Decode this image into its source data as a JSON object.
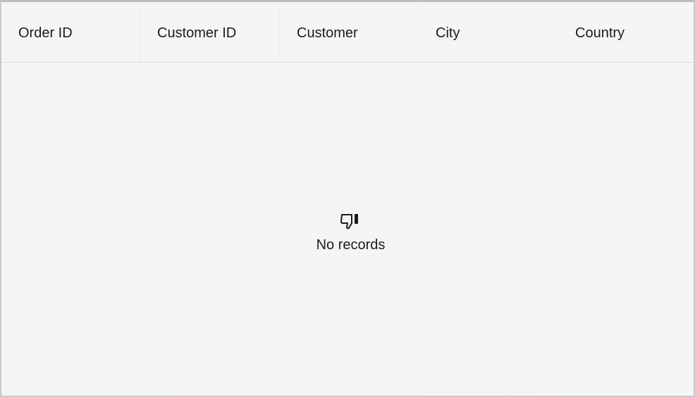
{
  "grid": {
    "columns": [
      {
        "label": "Order ID"
      },
      {
        "label": "Customer ID"
      },
      {
        "label": "Customer"
      },
      {
        "label": "City"
      },
      {
        "label": "Country"
      }
    ],
    "rows": [],
    "empty_state": {
      "icon": "thumbs-down-icon",
      "message": "No records"
    }
  },
  "colors": {
    "header_background": "#f5f5f5",
    "body_background": "#f4f5f5",
    "text": "#1b1b1b",
    "border": "#c9c9c9"
  }
}
